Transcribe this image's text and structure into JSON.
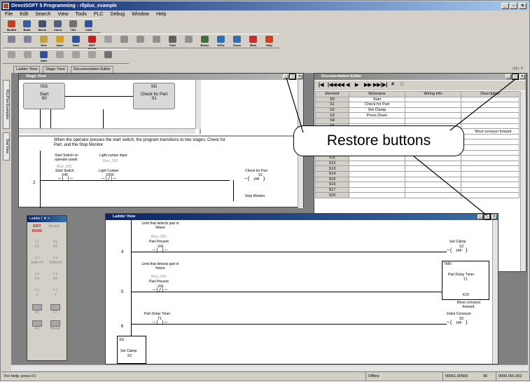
{
  "app": {
    "title": "DirectSOFT 5 Programming - rllplus_example",
    "title_controls": [
      "_",
      "▫",
      "×"
    ]
  },
  "menu": [
    "File",
    "Edit",
    "Search",
    "View",
    "Tools",
    "PLC",
    "Debug",
    "Window",
    "Help"
  ],
  "toolbar1": [
    {
      "icon": "modify-icon",
      "label": "ModEd",
      "color": "#c04020"
    },
    {
      "icon": "build-icon",
      "label": "Build",
      "color": "#3060a0"
    },
    {
      "icon": "mnemonics-icon",
      "label": "Mnem",
      "color": "#405070"
    },
    {
      "icon": "constants-icon",
      "label": "Const",
      "color": "#506080"
    },
    {
      "icon": "title-icon",
      "label": "Title",
      "color": "#707070"
    },
    {
      "icon": "coils-icon",
      "label": "CoNt",
      "color": "#3050a0"
    }
  ],
  "toolbar2": [
    {
      "icon": "new-icon",
      "label": "",
      "color": "#8080a0"
    },
    {
      "icon": "open-icon",
      "label": "",
      "color": "#8080a0"
    },
    {
      "icon": "new-icon",
      "label": "New",
      "color": "#c0a040"
    },
    {
      "icon": "open-icon",
      "label": "Open",
      "color": "#d0a030"
    },
    {
      "icon": "save-icon",
      "label": "Save",
      "color": "#3050a0"
    },
    {
      "icon": "edit-mode-icon",
      "label": "EDIT MODE",
      "color": "#c02020"
    },
    {
      "icon": "accept-icon",
      "label": "",
      "color": "#a0a0a0"
    },
    {
      "icon": "copy-icon",
      "label": "",
      "color": "#909090"
    },
    {
      "icon": "paste-icon",
      "label": "",
      "color": "#909090"
    },
    {
      "icon": "cut-icon",
      "label": "",
      "color": "#909090"
    },
    {
      "icon": "find-icon",
      "label": "Find",
      "color": "#606060"
    },
    {
      "icon": "replace-icon",
      "label": "",
      "color": "#909090"
    },
    {
      "icon": "browse-icon",
      "label": "Brwse",
      "color": "#407040"
    },
    {
      "icon": "data-view-icon",
      "label": "DtVw",
      "color": "#3070b0"
    },
    {
      "icon": "zoom-icon",
      "label": "Zoom",
      "color": "#3070b0"
    },
    {
      "icon": "mem-icon",
      "label": "Mem",
      "color": "#c03030"
    },
    {
      "icon": "help-icon",
      "label": "Help",
      "color": "#d04020"
    }
  ],
  "toolbar3": [
    {
      "icon": "rung-left-icon",
      "label": "",
      "color": "#a0a0a0"
    },
    {
      "icon": "rung-right-icon",
      "label": "",
      "color": "#a0a0a0"
    },
    {
      "icon": "data-icon",
      "label": "Data",
      "color": "#3050a0"
    },
    {
      "icon": "status-icon",
      "label": "",
      "color": "#a0a0a0"
    },
    {
      "icon": "run-icon",
      "label": "",
      "color": "#a0a0a0"
    },
    {
      "icon": "stop-icon",
      "label": "",
      "color": "#a0a0a0"
    },
    {
      "icon": "chart-icon",
      "label": "",
      "color": "#707070"
    }
  ],
  "tabs": [
    "Ladder View",
    "Stage View",
    "Documentation Editor"
  ],
  "side_tabs": [
    "RLLPlus Examples",
    "Stat View"
  ],
  "tab_nav": "◁ ▷ ×",
  "stage_view": {
    "title": "Stage View",
    "boxes": [
      {
        "addr": "ISG",
        "name": "Start",
        "stage": "S0"
      },
      {
        "addr": "SG",
        "name": "Check for Part",
        "stage": "S1"
      }
    ],
    "description": "When the operator presses the start switch, the program transitions to two stages; Check for Part, and the Stop Monitor.",
    "rung_num": "2",
    "contacts": [
      {
        "doc": "Start Switch on operator panel.",
        "blue": "Blue_000",
        "nick": "Start Switch",
        "addr": "X40"
      },
      {
        "doc": "Light curtain input",
        "blue": "Blue_200",
        "nick": "Light Curtain",
        "addr": "X200"
      }
    ],
    "jmp1_name": "Check for Part",
    "jmp1_stage": "S1",
    "jmp2_name": "Stop Monitor",
    "jmp_label": "JMP"
  },
  "doc_editor": {
    "title": "Documentation Editor",
    "nav": [
      "|◀",
      "|◀◀",
      "◀◀",
      "◀",
      "▶",
      "▶▶",
      "▶▶|",
      "▶|",
      "#",
      "□"
    ],
    "headers": [
      "Element",
      "Nickname",
      "Wiring Info",
      "Description"
    ],
    "rows": [
      [
        "S0",
        "Start",
        "",
        ""
      ],
      [
        "S1",
        "Check for Part",
        "",
        ""
      ],
      [
        "S2",
        "Set Clamp",
        "",
        ""
      ],
      [
        "S3",
        "Press Down",
        "",
        ""
      ],
      [
        "S4",
        "",
        "",
        ""
      ],
      [
        "S5",
        "",
        "",
        ""
      ],
      [
        "S6",
        "",
        "",
        ""
      ],
      [
        "S7",
        "",
        "",
        ""
      ],
      [
        "S8",
        "",
        "",
        ""
      ],
      [
        "S9",
        "Stop Monitor",
        "",
        ""
      ],
      [
        "S10",
        "",
        "",
        ""
      ],
      [
        "S11",
        "",
        "",
        ""
      ],
      [
        "S12",
        "",
        "",
        ""
      ],
      [
        "S13",
        "",
        "",
        ""
      ],
      [
        "S14",
        "",
        "",
        ""
      ],
      [
        "S15",
        "",
        "",
        ""
      ],
      [
        "S16",
        "",
        "",
        ""
      ],
      [
        "S17",
        "",
        "",
        ""
      ],
      [
        "S20",
        "",
        "",
        ""
      ]
    ],
    "s5_desc": "Move conveyor forward."
  },
  "callout": "Restore buttons",
  "ladder_view": {
    "title": "Ladder View",
    "rungs": [
      {
        "num": "4",
        "doc": "Limit that detects part in fixture",
        "blue": "Blue_000",
        "nick": "Part Present",
        "addr": "X41",
        "out_name": "Set Clamp",
        "out_addr": "S2"
      },
      {
        "num": "5",
        "doc": "Limit that detects part in fixture",
        "blue": "Blue_000",
        "nick": "Part Present",
        "addr": "X41",
        "tmr_type": "TMR",
        "tmr_name": "Part Delay Timer",
        "tmr_addr": "T1",
        "tmr_preset": "K10"
      },
      {
        "num": "6",
        "nick": "Part Delay Timer",
        "addr": "T1",
        "out_doc": "Move conveyor forward.",
        "out_name": "Index Conveyor",
        "out_addr": "S5"
      }
    ],
    "stage_addr": "SG",
    "stage_name": "Set Clamp",
    "stage_num": "S2",
    "jmp_label": "JMP"
  },
  "palette": {
    "title": "Ladder I ▼ ×",
    "top": [
      "EDIT MODE",
      "Accept"
    ],
    "buttons": [
      [
        "-| |-",
        "F2"
      ],
      [
        "-|/|-",
        "F3"
      ],
      [
        "-|↑|-",
        "Shift+F2"
      ],
      [
        "-|↓|-",
        "Shift+F3"
      ],
      [
        "-( )-",
        "F4"
      ],
      [
        "-( )-",
        "F5"
      ],
      [
        "-| |-",
        ">"
      ],
      [
        "-| |-",
        "<"
      ],
      [
        "box",
        "F6"
      ],
      [
        "box",
        "F7"
      ],
      [
        "box",
        "F8"
      ],
      [
        "box",
        "Brwse"
      ]
    ]
  },
  "status": {
    "help": "For Help, press F1",
    "mode": "Offline",
    "address": "00061,00560",
    "num": "06",
    "addr2": "0000.001.002"
  }
}
